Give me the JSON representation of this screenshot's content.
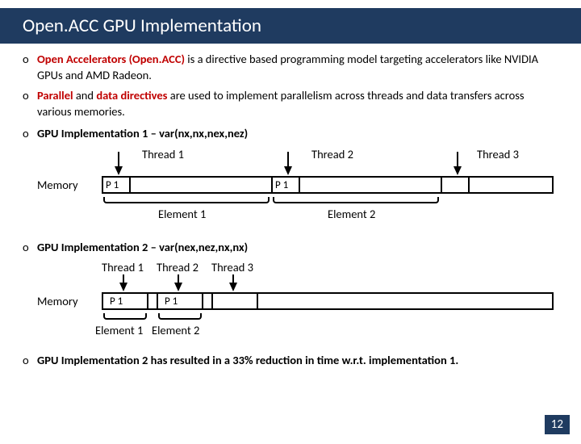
{
  "title": "Open.ACC GPU Implementation",
  "bullets": {
    "b1a": "Open Accelerators (Open.ACC)",
    "b1b": " is a directive based programming model targeting accelerators like NVIDIA GPUs and AMD Radeon.",
    "b2a": "Parallel",
    "b2b": " and ",
    "b2c": "data directives",
    "b2d": " are used to implement parallelism across threads and data transfers across various memories.",
    "b3": "GPU Implementation 1 – var(nx,nx,nex,nez)",
    "b4": "GPU Implementation 2 – var(nex,nez,nx,nx)",
    "b5": "GPU Implementation 2 has resulted in a 33% reduction in time w.r.t. implementation 1."
  },
  "diagram": {
    "memory": "Memory",
    "p1": "P 1",
    "t1": "Thread 1",
    "t2": "Thread 2",
    "t3": "Thread 3",
    "e1": "Element 1",
    "e2": "Element 2"
  },
  "page": "12",
  "marker": "o"
}
